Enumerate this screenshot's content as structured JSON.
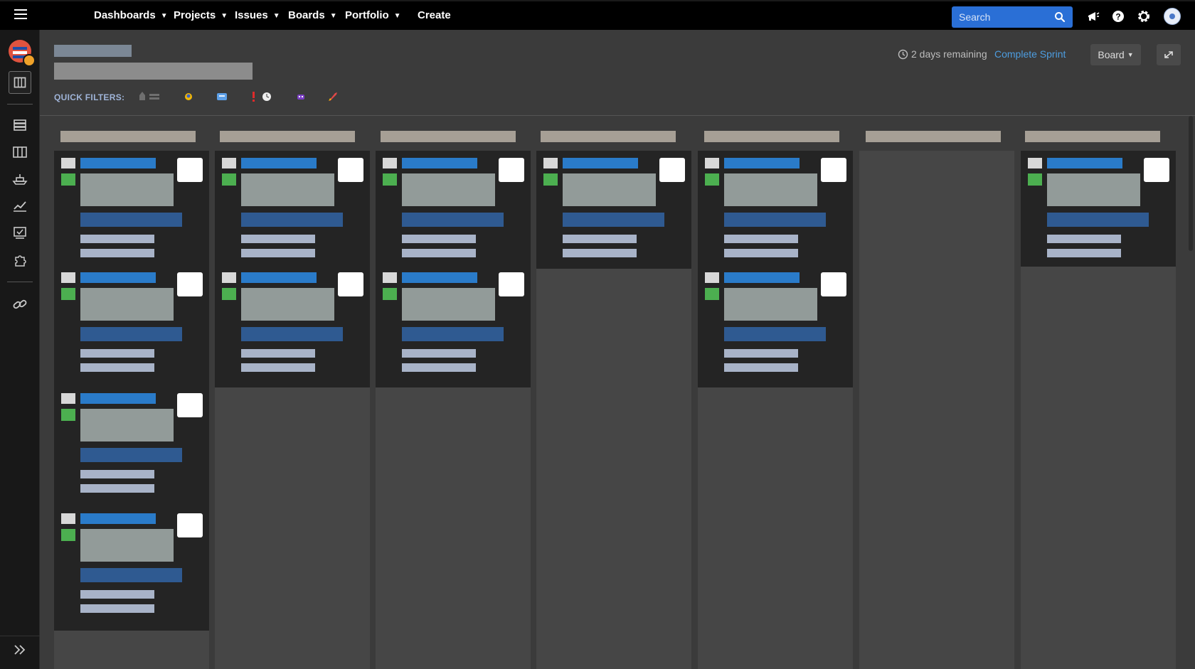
{
  "nav": {
    "items": [
      {
        "label": "Dashboards"
      },
      {
        "label": "Projects"
      },
      {
        "label": "Issues"
      },
      {
        "label": "Boards"
      },
      {
        "label": "Portfolio"
      }
    ],
    "create_label": "Create",
    "search_placeholder": "Search",
    "icons": [
      "menu-icon",
      "notifications-icon",
      "help-icon",
      "settings-icon",
      "avatar"
    ]
  },
  "sidebar": {
    "icons": [
      "project-logo",
      "board-icon",
      "backlog-icon",
      "columns-icon",
      "releases-icon",
      "reports-icon",
      "issues-icon",
      "components-icon",
      "link-icon",
      "expand-sidebar-icon"
    ]
  },
  "header": {
    "quick_filters_label": "QUICK FILTERS:",
    "sprint_remaining": "2 days remaining",
    "complete_sprint": "Complete Sprint",
    "board_menu": "Board",
    "quick_filter_icons": [
      "quick-filter-1",
      "quick-filter-2",
      "quick-filter-3",
      "quick-filter-4",
      "quick-filter-5",
      "quick-filter-6"
    ]
  },
  "board": {
    "columns": [
      {
        "card_count": 4
      },
      {
        "card_count": 2
      },
      {
        "card_count": 2
      },
      {
        "card_count": 1
      },
      {
        "card_count": 2
      },
      {
        "card_count": 0
      },
      {
        "card_count": 1
      }
    ]
  },
  "colors": {
    "nav_bg": "#000000",
    "search_bg": "#2a6fd6",
    "link": "#4d9de0",
    "card_key": "#2a7bc9",
    "priority": "#4caf50"
  }
}
